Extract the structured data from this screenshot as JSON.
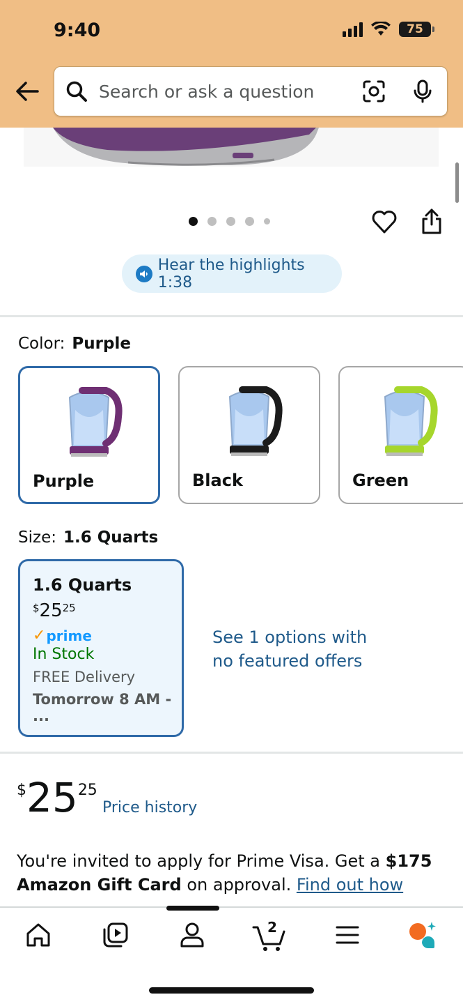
{
  "status_bar": {
    "time": "9:40",
    "battery": "75"
  },
  "header": {
    "search_placeholder": "Search or ask a question"
  },
  "highlights": {
    "label": "Hear the highlights 1:38"
  },
  "color": {
    "label": "Color:",
    "selected": "Purple",
    "options": [
      {
        "label": "Purple",
        "accent": "#6f2f73"
      },
      {
        "label": "Black",
        "accent": "#1b1b1b"
      },
      {
        "label": "Green",
        "accent": "#a6d62c"
      }
    ]
  },
  "size": {
    "label": "Size:",
    "selected": "1.6 Quarts",
    "card": {
      "title": "1.6 Quarts",
      "price_dollar": "$",
      "price_whole": "25",
      "price_cents": "25",
      "prime": "prime",
      "stock": "In Stock",
      "free": "FREE Delivery",
      "delivery": "Tomorrow 8 AM - ..."
    },
    "see_options": "See 1 options with no featured offers"
  },
  "price": {
    "dollar": "$",
    "whole": "25",
    "cents": "25",
    "history": "Price history"
  },
  "invite": {
    "text1": "You're invited to apply for Prime Visa. Get a ",
    "bold1": "$175",
    "bold2": "Amazon Gift Card",
    "text2": " on approval. ",
    "link": "Find out how"
  },
  "nav": {
    "cart_count": "2"
  },
  "colors": {
    "header_bg": "#f0be85",
    "link": "#1f5a8a",
    "selected_border": "#2f6aa8",
    "in_stock": "#007600"
  }
}
